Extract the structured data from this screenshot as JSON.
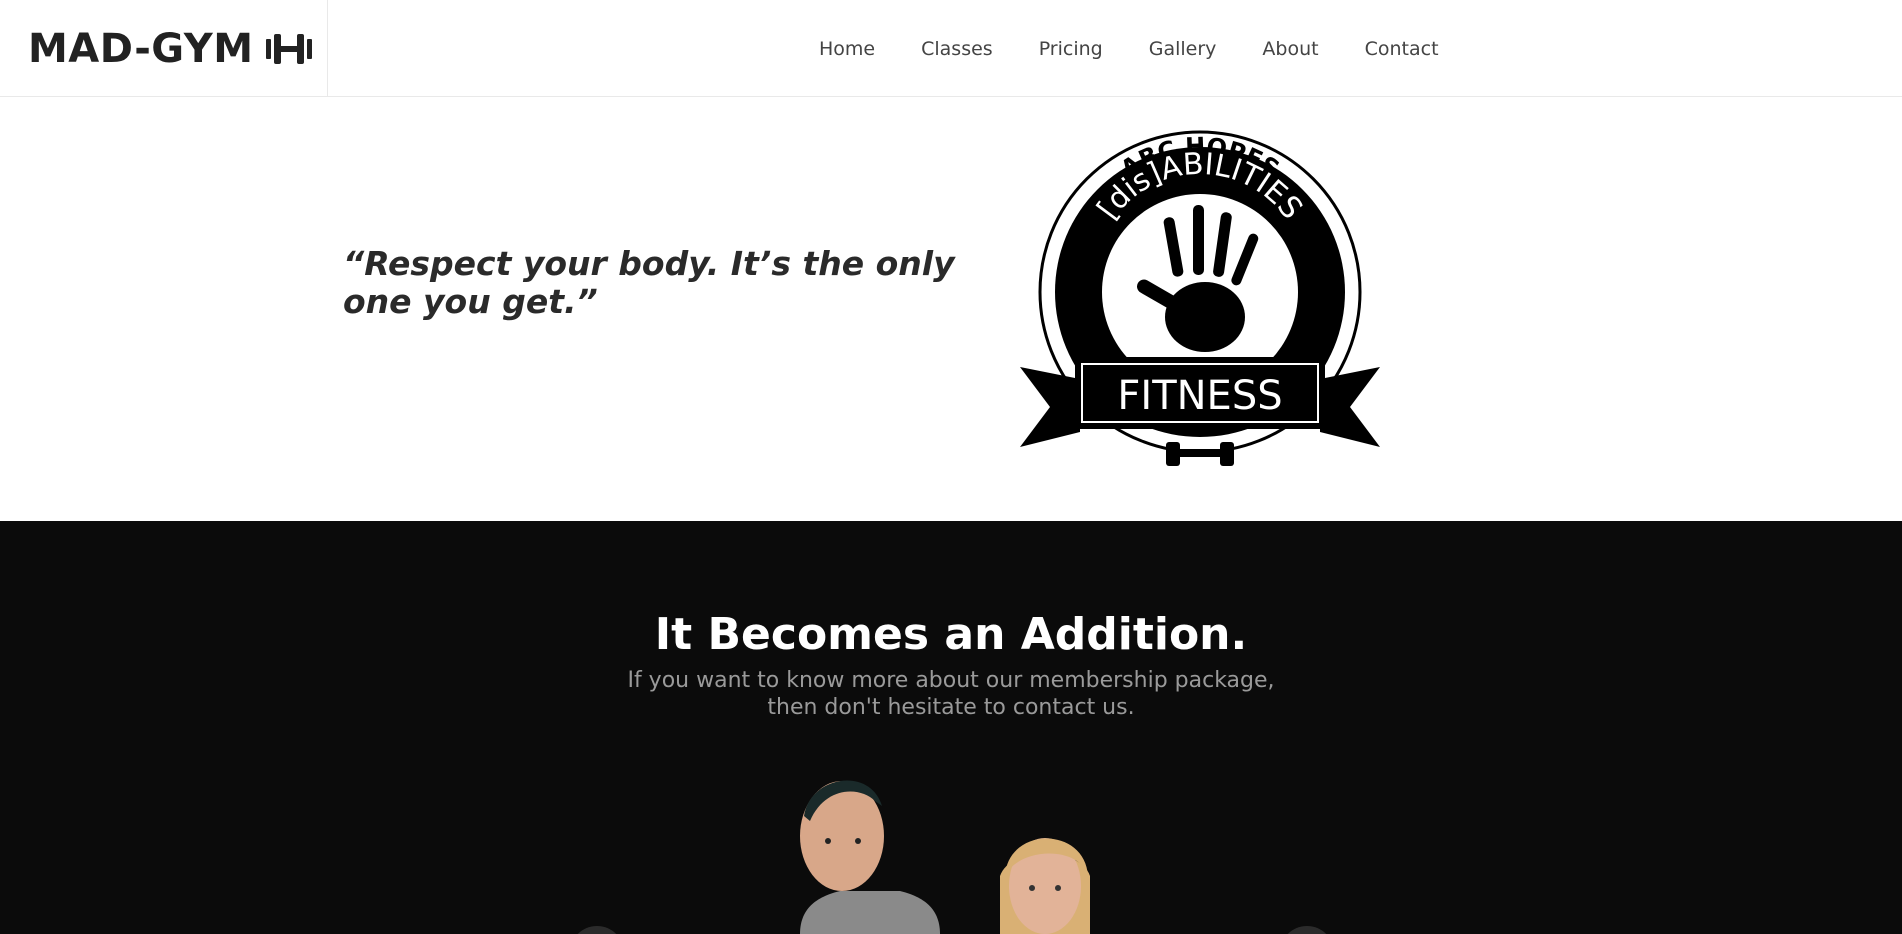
{
  "header": {
    "brand": "MAD-GYM",
    "brand_icon": "dumbbell-icon",
    "nav": [
      "Home",
      "Classes",
      "Pricing",
      "Gallery",
      "About",
      "Contact"
    ]
  },
  "hero": {
    "quote": "“Respect your body. It’s the only one you get.”",
    "logo": {
      "top_text": "ABC HOPES",
      "ring_text": "[dis]ABILITIES",
      "banner_text": "FITNESS"
    }
  },
  "membership": {
    "title": "It Becomes an Addition.",
    "subtitle_line1": "If you want to know more about our membership package,",
    "subtitle_line2": "then don't hesitate to contact us."
  },
  "colors": {
    "dark_bg": "#0b0b0b",
    "text_dark": "#222222",
    "subtitle_gray": "#9a9a9a"
  }
}
